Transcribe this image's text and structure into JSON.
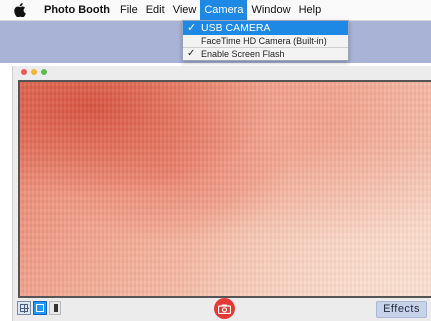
{
  "menubar": {
    "apple_icon": "apple-logo-icon",
    "app_name": "Photo Booth",
    "items": [
      "File",
      "Edit",
      "View",
      "Camera",
      "Window",
      "Help"
    ],
    "active_item": "Camera"
  },
  "camera_menu": {
    "items": [
      {
        "label": "USB CAMERA",
        "checked": true,
        "selected": true
      },
      {
        "label": "FaceTime HD Camera (Built-in)",
        "checked": false,
        "selected": false
      },
      {
        "label": "Enable Screen Flash",
        "checked": true,
        "selected": false
      }
    ]
  },
  "window": {
    "traffic_lights": [
      "close",
      "minimize",
      "zoom"
    ],
    "colors": {
      "accent": "#1e88e5",
      "shutter": "#e53935"
    }
  },
  "toolbar": {
    "view_buttons": [
      {
        "name": "grid-view",
        "icon": "grid-icon",
        "active": false
      },
      {
        "name": "single-view",
        "icon": "square-icon",
        "active": true
      },
      {
        "name": "strip-view",
        "icon": "strip-icon",
        "active": false
      }
    ],
    "shutter_icon": "camera-icon",
    "effects_label": "Effects"
  }
}
